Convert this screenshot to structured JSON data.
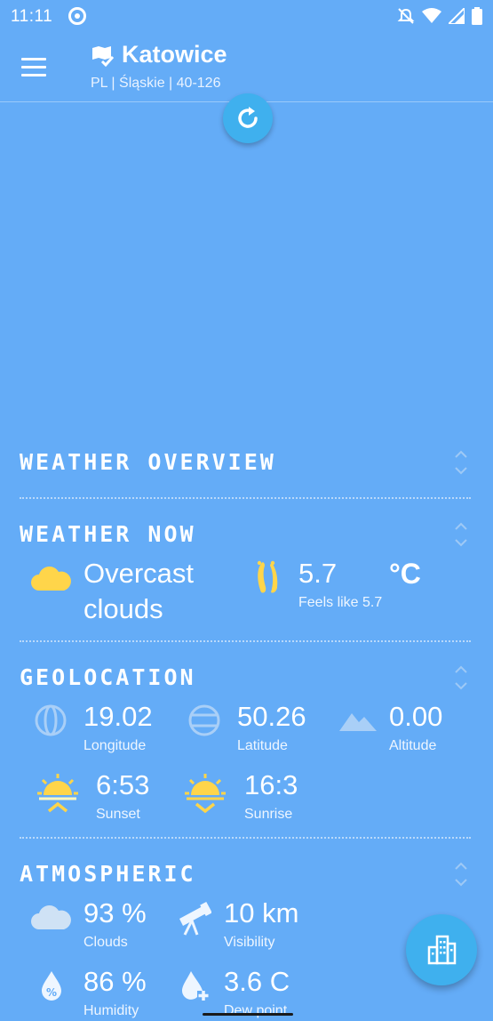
{
  "status_bar": {
    "time": "11:11"
  },
  "header": {
    "city": "Katowice",
    "region": "PL | Śląskie | 40-126"
  },
  "sections": {
    "overview": {
      "title": "WEATHER OVERVIEW"
    },
    "now": {
      "title": "WEATHER NOW",
      "condition_line1": "Overcast",
      "condition_line2": "clouds",
      "temp": "5.7",
      "unit": "°C",
      "feels_like": "Feels like 5.7"
    },
    "geolocation": {
      "title": "GEOLOCATION",
      "longitude_value": "19.02",
      "longitude_label": "Longitude",
      "latitude_value": "50.26",
      "latitude_label": "Latitude",
      "altitude_value": "0.00",
      "altitude_label": "Altitude",
      "sunset_value": "6:53",
      "sunset_label": "Sunset",
      "sunrise_value": "16:3",
      "sunrise_label": "Sunrise"
    },
    "atmospheric": {
      "title": "ATMOSPHERIC",
      "clouds_value": "93 %",
      "clouds_label": "Clouds",
      "visibility_value": "10 km",
      "visibility_label": "Visibility",
      "humidity_value": "86 %",
      "humidity_label": "Humidity",
      "dew_value": "3.6 C",
      "dew_label": "Dew point"
    }
  },
  "colors": {
    "background": "#64acf7",
    "accent": "#3fb0ee",
    "sun": "#ffd54a"
  }
}
